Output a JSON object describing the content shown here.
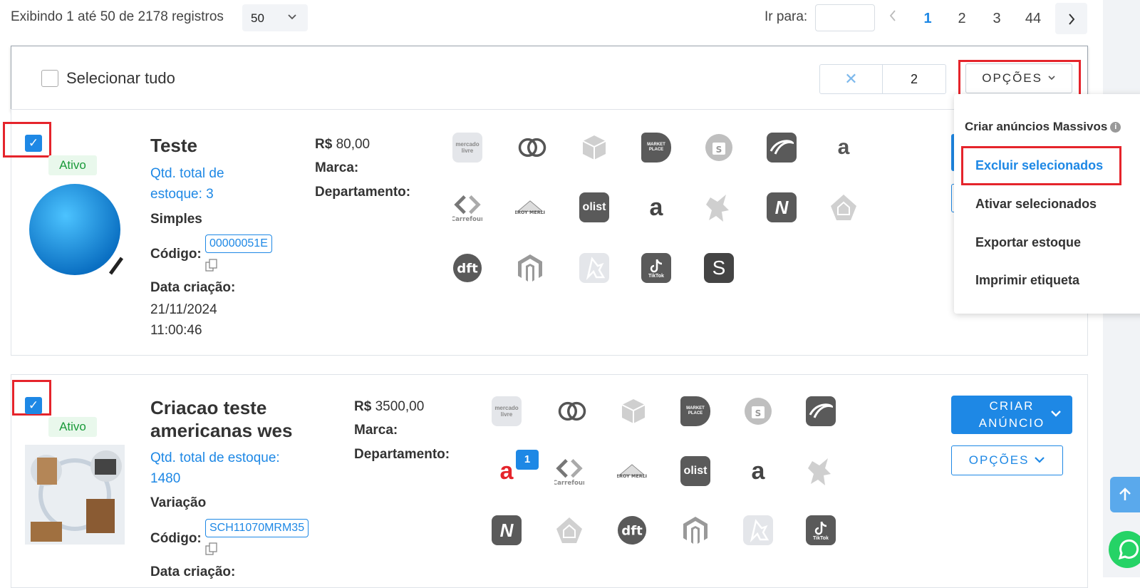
{
  "top": {
    "showing": "Exibindo 1 até 50 de 2178 registros",
    "per_page": "50",
    "goto_label": "Ir para:",
    "goto_value": "",
    "pages": [
      "1",
      "2",
      "3",
      "44"
    ],
    "current_page": "1",
    "prev_icon": "chevron-left-icon",
    "next_icon": "chevron-right-icon"
  },
  "selection": {
    "select_all_label": "Selecionar tudo",
    "selected_count": "2",
    "clear_icon": "close-icon",
    "options_label": "OPÇÕES"
  },
  "dropdown": {
    "items": [
      "Criar anúncios Massivos",
      "Excluir selecionados",
      "Ativar selecionados",
      "Exportar estoque",
      "Imprimir etiqueta"
    ],
    "highlighted": "Excluir selecionados"
  },
  "products": [
    {
      "status": "Ativo",
      "name": "Teste",
      "stock": "Qtd. total de estoque: 3",
      "type": "Simples",
      "code_label": "Código:",
      "code": "00000051E",
      "date_label": "Data criação:",
      "date": "21/11/2024",
      "time": "11:00:46",
      "price_prefix": "R$",
      "price": "80,00",
      "brand_label": "Marca:",
      "dept_label": "Departamento:",
      "checked": true
    },
    {
      "status": "Ativo",
      "name_line1": "Criacao teste",
      "name_line2": "americanas wes",
      "stock": "Qtd. total de estoque:",
      "stock_value": "1480",
      "type": "Variação",
      "code_label": "Código:",
      "code": "SCH11070MRM35",
      "date_label": "Data criação:",
      "price_prefix": "R$",
      "price": "3500,00",
      "brand_label": "Marca:",
      "dept_label": "Departamento:",
      "create_ad_line1": "CRIAR",
      "create_ad_line2": "ANÚNCIO",
      "options_label": "OPÇÕES",
      "americanas_badge": "1",
      "checked": true
    }
  ],
  "marketplace_logos": {
    "mercadolivre": "mercado livre",
    "marketplace": "MARKET PLACE",
    "carrefour": "Carrefour",
    "leroy": "LEROY MERLIN",
    "olist": "olist",
    "amazon": "a",
    "netshoes": "N",
    "dft": "dft",
    "tiktok": "TikTok",
    "shopee_s": "S",
    "americanas": "a"
  },
  "colors": {
    "primary": "#1e88e5",
    "highlight_box": "#e5242b",
    "active_green": "#1a9a3a"
  }
}
